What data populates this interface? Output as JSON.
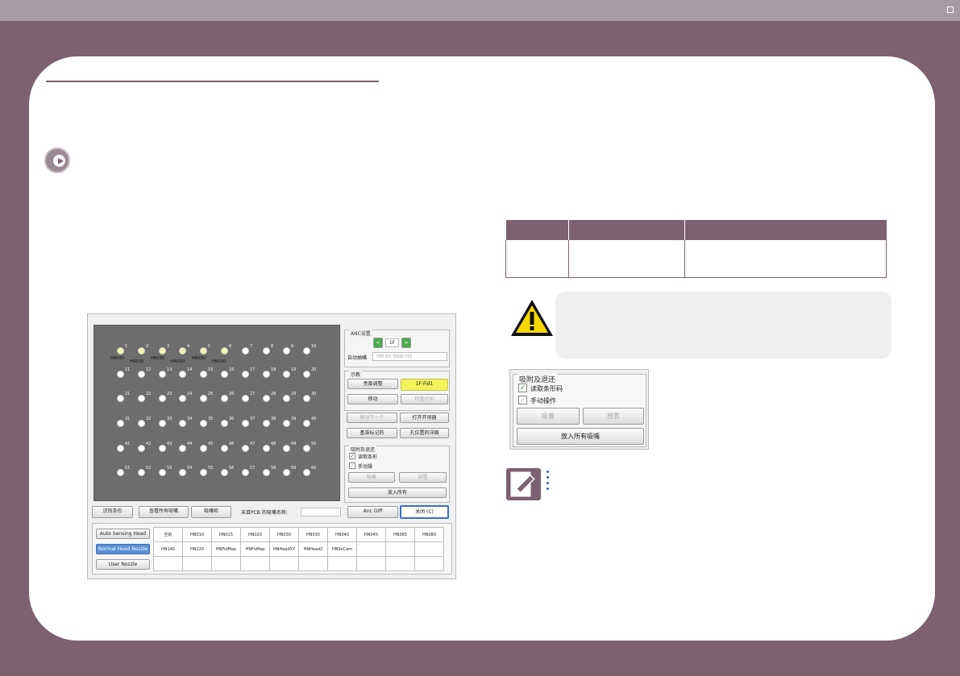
{
  "board": {
    "nozzles": [
      {
        "n": "1",
        "active": true
      },
      {
        "n": "2",
        "active": true
      },
      {
        "n": "3",
        "active": true
      },
      {
        "n": "4",
        "active": true
      },
      {
        "n": "5",
        "active": true
      },
      {
        "n": "6",
        "active": true
      },
      {
        "n": "7",
        "active": false
      },
      {
        "n": "8",
        "active": false
      },
      {
        "n": "9",
        "active": false
      },
      {
        "n": "10",
        "active": false
      },
      {
        "n": "11",
        "active": false
      },
      {
        "n": "12",
        "active": false
      },
      {
        "n": "13",
        "active": false
      },
      {
        "n": "14",
        "active": false
      },
      {
        "n": "15",
        "active": false
      },
      {
        "n": "16",
        "active": false
      },
      {
        "n": "17",
        "active": false
      },
      {
        "n": "18",
        "active": false
      },
      {
        "n": "19",
        "active": false
      },
      {
        "n": "20",
        "active": false
      },
      {
        "n": "21",
        "active": false
      },
      {
        "n": "22",
        "active": false
      },
      {
        "n": "23",
        "active": false
      },
      {
        "n": "24",
        "active": false
      },
      {
        "n": "25",
        "active": false
      },
      {
        "n": "26",
        "active": false
      },
      {
        "n": "27",
        "active": false
      },
      {
        "n": "28",
        "active": false
      },
      {
        "n": "29",
        "active": false
      },
      {
        "n": "30",
        "active": false
      },
      {
        "n": "31",
        "active": false
      },
      {
        "n": "32",
        "active": false
      },
      {
        "n": "33",
        "active": false
      },
      {
        "n": "34",
        "active": false
      },
      {
        "n": "35",
        "active": false
      },
      {
        "n": "36",
        "active": false
      },
      {
        "n": "37",
        "active": false
      },
      {
        "n": "38",
        "active": false
      },
      {
        "n": "39",
        "active": false
      },
      {
        "n": "40",
        "active": false
      },
      {
        "n": "41",
        "active": false
      },
      {
        "n": "42",
        "active": false
      },
      {
        "n": "43",
        "active": false
      },
      {
        "n": "44",
        "active": false
      },
      {
        "n": "45",
        "active": false
      },
      {
        "n": "46",
        "active": false
      },
      {
        "n": "47",
        "active": false
      },
      {
        "n": "48",
        "active": false
      },
      {
        "n": "49",
        "active": false
      },
      {
        "n": "50",
        "active": false
      },
      {
        "n": "51",
        "active": false
      },
      {
        "n": "52",
        "active": false
      },
      {
        "n": "53",
        "active": false
      },
      {
        "n": "54",
        "active": false
      },
      {
        "n": "55",
        "active": false
      },
      {
        "n": "56",
        "active": false
      },
      {
        "n": "57",
        "active": false
      },
      {
        "n": "58",
        "active": false
      },
      {
        "n": "59",
        "active": false
      },
      {
        "n": "60",
        "active": false
      }
    ],
    "labels": [
      "HN030",
      "HN030",
      "HN030",
      "HN030",
      "HN030",
      "HN030"
    ]
  },
  "anc": {
    "title": "ANC设置",
    "layer": "1F",
    "auto_label": "自动抽嘴",
    "auto_value": "HN 60 Hole HS"
  },
  "display": {
    "title": "示教",
    "brightness": "亮度调整",
    "fid": "1F-Fid1",
    "move": "移动",
    "check": "检查(F9)",
    "move_next": "移动下一个",
    "open_close": "打开开闭器",
    "base_mark": "基准标记的",
    "hole_detail": "孔位置的详细"
  },
  "suction_small": {
    "title": "吸附及退还",
    "read_barcode": "读取条形",
    "manual": "手动操",
    "suck": "吸着",
    "release": "放置",
    "put_all": "放入所有"
  },
  "bottom": {
    "recognize": "识别条形",
    "view_all": "查看所有吸嘴",
    "check": "吸嘴检",
    "pcb_label": "末目PCB 的吸嘴名称:",
    "anc_diff": "Anc Diff",
    "close": "关闭 (C)"
  },
  "nozzle_buttons": {
    "auto": "Auto Sensing Head",
    "normal": "Normal Head Nozzle",
    "user": "User Nozzle"
  },
  "nozzle_table": [
    [
      "空的",
      "HN010",
      "HN015",
      "HN020",
      "HN030",
      "HN035",
      "HN040",
      "HN045",
      "HN065",
      "HN080"
    ],
    [
      "HN140",
      "HN220",
      "HNFidMap",
      "HNFoMap",
      "HNHeadXY",
      "HNHead2",
      "HNSvCam",
      "",
      "",
      ""
    ],
    [
      "",
      "",
      "",
      "",
      "",
      "",
      "",
      "",
      "",
      ""
    ]
  ],
  "suction_panel": {
    "title": "吸附及退还",
    "read_barcode": "读取条形码",
    "manual": "手动操作",
    "suck": "吸着",
    "release": "放置",
    "put_all": "放入所有吸嘴"
  },
  "colors": {
    "brand": "#7d6170",
    "accent_yellow": "#f2f25c",
    "accent_blue": "#5b8fd4"
  }
}
